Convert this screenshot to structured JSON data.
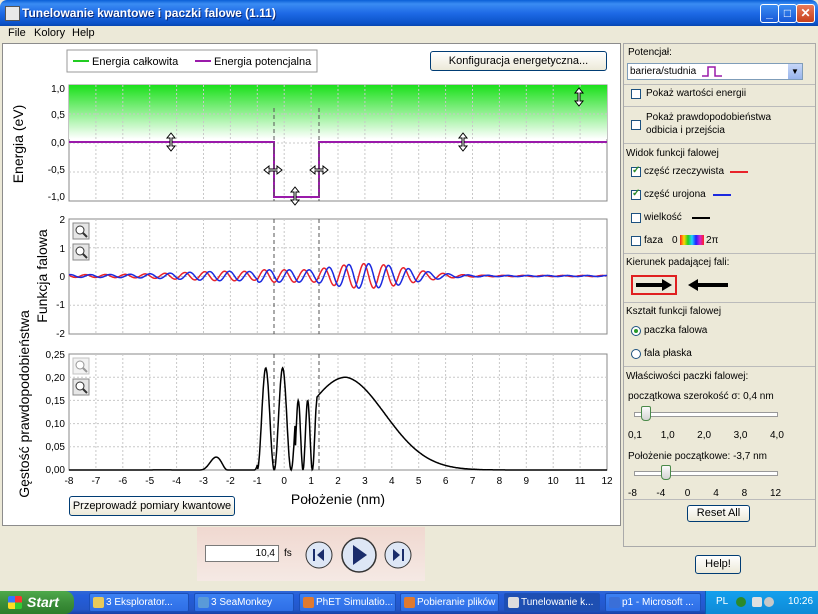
{
  "window": {
    "title": "Tunelowanie kwantowe i paczki falowe (1.11)"
  },
  "menu": [
    "File",
    "Kolory",
    "Help"
  ],
  "legend": {
    "total": "Energia całkowita",
    "potential": "Energia potencjalna",
    "total_color": "#22cc22",
    "potential_color": "#9a1aaa"
  },
  "energy_config_button": "Konfiguracja energetyczna...",
  "energy_plot": {
    "ylabel": "Energia (eV)",
    "ticks": [
      "1,0",
      "0,5",
      "0,0",
      "-0,5",
      "-1,0"
    ]
  },
  "wave_plot": {
    "ylabel": "Funkcja falowa",
    "ticks": [
      "2",
      "1",
      "0",
      "-1",
      "-2"
    ]
  },
  "prob_plot": {
    "ylabel": "Gęstość prawdopodobieństwa",
    "ticks": [
      "0,25",
      "0,20",
      "0,15",
      "0,10",
      "0,05",
      "0,00"
    ]
  },
  "x_axis": {
    "label": "Położenie (nm)",
    "ticks": [
      "-8",
      "-7",
      "-6",
      "-5",
      "-4",
      "-3",
      "-2",
      "-1",
      "0",
      "1",
      "2",
      "3",
      "4",
      "5",
      "6",
      "7",
      "8",
      "9",
      "10",
      "11",
      "12"
    ]
  },
  "measure_button": "Przeprowadź pomiary kwantowe",
  "time": {
    "value": "10,4",
    "unit": "fs"
  },
  "right": {
    "potential_label": "Potencjał:",
    "potential_value": "bariera/studnia",
    "show_energy": "Pokaż wartości energii",
    "show_prob_1": "Pokaż prawdopodobieństwa",
    "show_prob_2": "odbicia i przejścia",
    "wave_view_title": "Widok funkcji falowej",
    "real_part": "część rzeczywista",
    "imag_part": "część urojona",
    "magnitude": "wielkość",
    "phase": "faza",
    "phase_min": "0",
    "phase_max": "2π",
    "direction_title": "Kierunek padającej fali:",
    "shape_title": "Kształt funkcji falowej",
    "wave_packet": "paczka falowa",
    "plane_wave": "fala płaska",
    "props_title": "Właściwości paczki falowej:",
    "width_label": "początkowa szerokość σ: 0,4 nm",
    "width_ticks": [
      "0,1",
      "1,0",
      "2,0",
      "3,0",
      "4,0"
    ],
    "width_value": 0.4,
    "pos_label": "Położenie początkowe: -3,7 nm",
    "pos_ticks": [
      "-8",
      "-4",
      "0",
      "4",
      "8",
      "12"
    ],
    "pos_value": -3.7,
    "reset": "Reset All"
  },
  "help": "Help!",
  "taskbar": {
    "start": "Start",
    "items": [
      "3 Eksplorator...",
      "3 SeaMonkey",
      "PhET Simulatio...",
      "Pobieranie plików",
      "Tunelowanie k...",
      "p1 - Microsoft ..."
    ],
    "lang": "PL",
    "clock": "10:26"
  }
}
